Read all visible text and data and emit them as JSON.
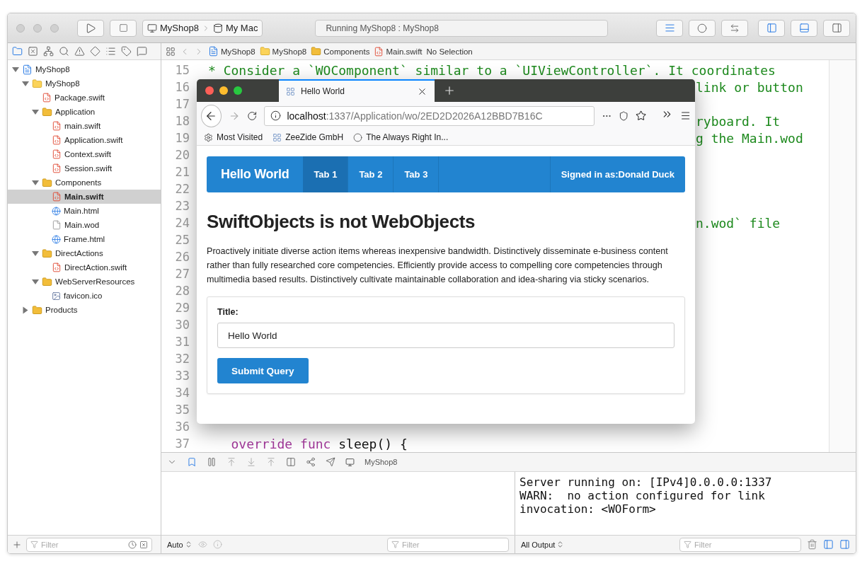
{
  "toolbar": {
    "scheme": "MyShop8",
    "destination": "My Mac",
    "status": "Running MyShop8 : MyShop8",
    "panels": [
      {
        "on": true
      },
      {
        "on": true
      },
      {
        "on": false
      }
    ]
  },
  "navigator": {
    "tree": [
      {
        "label": "MyShop8",
        "kind": "project",
        "expanded": true,
        "selected": false,
        "children": [
          {
            "label": "MyShop8",
            "kind": "folder",
            "expanded": true,
            "selected": false,
            "children": [
              {
                "label": "Package.swift",
                "kind": "swift",
                "selected": false
              },
              {
                "label": "Application",
                "kind": "group",
                "expanded": true,
                "selected": false,
                "children": [
                  {
                    "label": "main.swift",
                    "kind": "swift",
                    "selected": false
                  },
                  {
                    "label": "Application.swift",
                    "kind": "swift",
                    "selected": false
                  },
                  {
                    "label": "Context.swift",
                    "kind": "swift",
                    "selected": false
                  },
                  {
                    "label": "Session.swift",
                    "kind": "swift",
                    "selected": false
                  }
                ]
              },
              {
                "label": "Components",
                "kind": "group",
                "expanded": true,
                "selected": false,
                "children": [
                  {
                    "label": "Main.swift",
                    "kind": "swift",
                    "selected": true
                  },
                  {
                    "label": "Main.html",
                    "kind": "html",
                    "selected": false
                  },
                  {
                    "label": "Main.wod",
                    "kind": "plain",
                    "selected": false
                  },
                  {
                    "label": "Frame.html",
                    "kind": "html",
                    "selected": false
                  }
                ]
              },
              {
                "label": "DirectActions",
                "kind": "group",
                "expanded": true,
                "selected": false,
                "children": [
                  {
                    "label": "DirectAction.swift",
                    "kind": "swift",
                    "selected": false
                  }
                ]
              },
              {
                "label": "WebServerResources",
                "kind": "group",
                "expanded": true,
                "selected": false,
                "children": [
                  {
                    "label": "favicon.ico",
                    "kind": "image",
                    "selected": false
                  }
                ]
              }
            ]
          },
          {
            "label": "Products",
            "kind": "group",
            "expanded": false,
            "selected": false
          }
        ]
      }
    ],
    "filter_placeholder": "Filter"
  },
  "jump_bar": [
    {
      "label": "MyShop8",
      "kind": "project"
    },
    {
      "label": "MyShop8",
      "kind": "folder"
    },
    {
      "label": "Components",
      "kind": "group"
    },
    {
      "label": "Main.swift",
      "kind": "swift"
    },
    {
      "label": "No Selection",
      "kind": "none"
    }
  ],
  "editor": {
    "lines": [
      {
        "number": "15",
        "kind": "full",
        "segments": [
          {
            "text": "* Consider a `WOComponent` similar to a `UIViewController`. It coordinates",
            "kind": "comment"
          }
        ]
      },
      {
        "number": "16",
        "kind": "clipped",
        "segments": [
          {
            "text": "link or button",
            "kind": "comment"
          }
        ]
      },
      {
        "number": "17"
      },
      {
        "number": "18",
        "kind": "clipped",
        "segments": [
          {
            "text": "ryboard. It",
            "kind": "comment"
          }
        ]
      },
      {
        "number": "19",
        "kind": "clipped",
        "segments": [
          {
            "text": "g the Main.wod",
            "kind": "comment"
          }
        ]
      },
      {
        "number": "20"
      },
      {
        "number": "21"
      },
      {
        "number": "22"
      },
      {
        "number": "23"
      },
      {
        "number": "24",
        "kind": "clipped",
        "segments": [
          {
            "text": "n.wod` file",
            "kind": "comment"
          }
        ]
      },
      {
        "number": "25"
      },
      {
        "number": "26"
      },
      {
        "number": "27"
      },
      {
        "number": "28"
      },
      {
        "number": "29"
      },
      {
        "number": "30"
      },
      {
        "number": "31"
      },
      {
        "number": "32"
      },
      {
        "number": "33"
      },
      {
        "number": "34"
      },
      {
        "number": "35"
      },
      {
        "number": "36"
      },
      {
        "number": "37",
        "kind": "full",
        "segments": [
          {
            "text": "   override func",
            "kind": "keyword"
          },
          {
            "text": " sleep() {",
            "kind": "plain"
          }
        ]
      }
    ]
  },
  "browser": {
    "tab_title": "Hello World",
    "url_host": "localhost",
    "url_rest": ":1337/Application/wo/2ED2D2026A12BBD7B16C",
    "bookmarks": [
      {
        "label": "Most Visited",
        "kind": "gear"
      },
      {
        "label": "ZeeZide GmbH",
        "kind": "site"
      },
      {
        "label": "The Always Right In...",
        "kind": "round"
      }
    ],
    "page": {
      "brand": "Hello World",
      "tabs": [
        {
          "label": "Tab 1",
          "selected": true
        },
        {
          "label": "Tab 2",
          "selected": false
        },
        {
          "label": "Tab 3",
          "selected": false
        }
      ],
      "signed_in": "Signed in as:Donald Duck",
      "heading": "SwiftObjects is not WebObjects",
      "paragraph": "Proactively initiate diverse action items whereas inexpensive bandwidth. Distinctively disseminate e-business content rather than fully researched core competencies. Efficiently provide access to compelling core competencies through multimedia based results. Distinctively cultivate maintainable collaboration and idea-sharing via sticky scenarios.",
      "form": {
        "label": "Title:",
        "value": "Hello World",
        "button": "Submit Query"
      }
    }
  },
  "debug": {
    "scheme": "MyShop8",
    "variables_mode": "Auto",
    "variables_filter": "Filter",
    "output_mode": "All Output",
    "console_filter": "Filter",
    "console_lines": [
      "Server running on: [IPv4]0.0.0.0:1337",
      "WARN:  no action configured for link",
      "invocation: <WOForm>"
    ]
  }
}
